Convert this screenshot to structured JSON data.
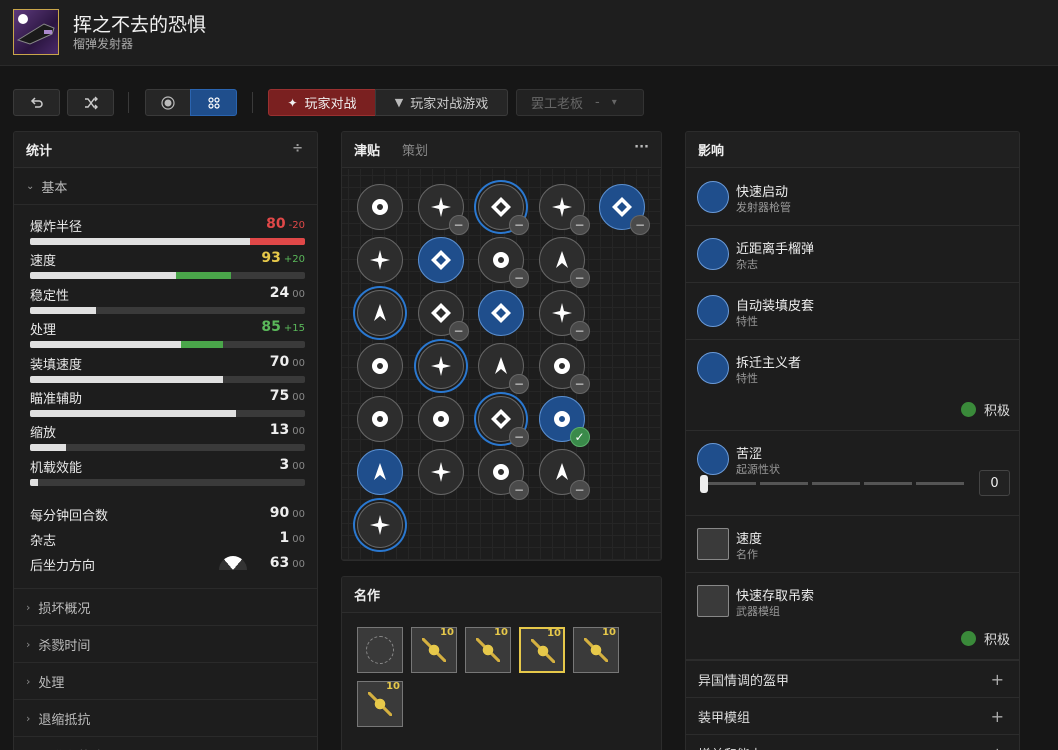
{
  "weapon": {
    "name": "挥之不去的恐惧",
    "type": "榴弹发射器",
    "accent": "#c9a64a"
  },
  "toolbar": {
    "undo_icon": "undo-icon",
    "shuffle_icon": "shuffle-icon",
    "view_toggle": [
      "radio-dot-icon",
      "grid-icon"
    ],
    "modes": [
      {
        "label": "玩家对战",
        "icon": "crucible-icon",
        "active": true
      },
      {
        "label": "玩家对战游戏",
        "icon": "vanguard-icon",
        "active": false
      }
    ],
    "loadout_select": {
      "value": "罢工老板",
      "dash": "-",
      "arrow": "▾"
    }
  },
  "stats": {
    "title": "统计",
    "section": "基本",
    "bars": [
      {
        "name": "爆炸半径",
        "value": "80",
        "delta": "-20",
        "value_color": "#e04848",
        "delta_color": "#e04848",
        "fill": 0.8,
        "change": -0.2,
        "change_color": "#e04848"
      },
      {
        "name": "速度",
        "value": "93",
        "delta": "+20",
        "value_color": "#e6c84a",
        "delta_color": "#5ab85a",
        "fill": 0.73,
        "change": 0.2,
        "change_color": "#4aa64a"
      },
      {
        "name": "稳定性",
        "value": "24",
        "delta": "00",
        "value_color": "#eeeeee",
        "delta_color": "#888888",
        "fill": 0.24,
        "change": 0,
        "change_color": ""
      },
      {
        "name": "处理",
        "value": "85",
        "delta": "+15",
        "value_color": "#5ab85a",
        "delta_color": "#5ab85a",
        "fill": 0.7,
        "change": 0.15,
        "change_color": "#4aa64a"
      },
      {
        "name": "装填速度",
        "value": "70",
        "delta": "00",
        "value_color": "#eeeeee",
        "delta_color": "#888888",
        "fill": 0.7,
        "change": 0,
        "change_color": ""
      },
      {
        "name": "瞄准辅助",
        "value": "75",
        "delta": "00",
        "value_color": "#eeeeee",
        "delta_color": "#888888",
        "fill": 0.75,
        "change": 0,
        "change_color": ""
      },
      {
        "name": "缩放",
        "value": "13",
        "delta": "00",
        "value_color": "#eeeeee",
        "delta_color": "#888888",
        "fill": 0.13,
        "change": 0,
        "change_color": ""
      },
      {
        "name": "机载效能",
        "value": "3",
        "delta": "00",
        "value_color": "#eeeeee",
        "delta_color": "#888888",
        "fill": 0.03,
        "change": 0,
        "change_color": ""
      }
    ],
    "plain": [
      {
        "name": "每分钟回合数",
        "value": "90",
        "delta": "00"
      },
      {
        "name": "杂志",
        "value": "1",
        "delta": "00"
      },
      {
        "name": "后坐力方向",
        "value": "63",
        "delta": "00"
      }
    ],
    "collapsed": [
      "损坏概况",
      "杀戮时间",
      "处理",
      "退缩抵抗",
      "瞄准和装填"
    ]
  },
  "perks": {
    "tabs": [
      "津贴",
      "策划"
    ],
    "menu": "···",
    "columns": [
      [
        {
          "icon": "rapid-launch-icon"
        },
        {
          "icon": "target-icon"
        },
        {
          "icon": "flame-icon",
          "ring": true
        },
        {
          "icon": "leaf-icon"
        },
        {
          "icon": "burst-icon"
        },
        {
          "icon": "ice-icon",
          "sel": true
        },
        {
          "icon": "feather-icon",
          "ring": true
        }
      ],
      [
        {
          "icon": "claw-icon",
          "minus": true
        },
        {
          "icon": "crosshair-icon",
          "sel": true
        },
        {
          "icon": "star-icon",
          "minus": true
        },
        {
          "icon": "slash-icon",
          "ring": true
        },
        {
          "icon": "reticle-icon"
        },
        {
          "icon": "sphere-icon"
        }
      ],
      [
        {
          "icon": "compass-icon",
          "ring": true,
          "minus": true
        },
        {
          "icon": "diamond-icon",
          "minus": true
        },
        {
          "icon": "auto-loading-holster-icon",
          "sel": true
        },
        {
          "icon": "bolt-icon",
          "minus": true
        },
        {
          "icon": "cross-icon",
          "ring": true,
          "minus": true
        },
        {
          "icon": "cycle-icon",
          "minus": true
        }
      ],
      [
        {
          "icon": "dragon-icon",
          "minus": true
        },
        {
          "icon": "wheel-icon",
          "minus": true
        },
        {
          "icon": "gear-icon",
          "minus": true
        },
        {
          "icon": "blade-icon",
          "minus": true
        },
        {
          "icon": "demolitionist-icon",
          "sel": true,
          "check": true
        },
        {
          "icon": "spark-icon",
          "minus": true
        }
      ],
      [
        {
          "icon": "bitter-icon",
          "sel": true,
          "minus": true
        }
      ]
    ]
  },
  "masterwork": {
    "title": "名作",
    "items": [
      {
        "icon": "empty-ring-icon",
        "level": "",
        "sel": false
      },
      {
        "icon": "blast-radius-mw-icon",
        "level": "10",
        "sel": false
      },
      {
        "icon": "handling-mw-icon",
        "level": "10",
        "sel": false
      },
      {
        "icon": "velocity-mw-icon",
        "level": "10",
        "sel": true
      },
      {
        "icon": "stability-mw-icon",
        "level": "10",
        "sel": false
      },
      {
        "icon": "reload-mw-icon",
        "level": "10",
        "sel": false
      }
    ]
  },
  "effects": {
    "title": "影响",
    "items": [
      {
        "title": "快速启动",
        "sub": "发射器枪管",
        "icon": "rapid-launch-icon"
      },
      {
        "title": "近距离手榴弹",
        "sub": "杂志",
        "icon": "grenade-icon"
      },
      {
        "title": "自动装填皮套",
        "sub": "特性",
        "icon": "auto-loading-holster-icon"
      },
      {
        "title": "拆迁主义者",
        "sub": "特性",
        "icon": "demolitionist-icon",
        "active": "积极"
      },
      {
        "title": "苦涩",
        "sub": "起源性状",
        "icon": "bitter-icon",
        "slider_value": "0",
        "slider_level": 0
      },
      {
        "title": "速度",
        "sub": "名作",
        "icon": "velocity-mw-icon"
      },
      {
        "title": "快速存取吊索",
        "sub": "武器模组",
        "icon": "quick-access-sling-icon",
        "active": "积极"
      }
    ],
    "expanders": [
      "异国情调的盔甲",
      "装甲模组",
      "增益和能力"
    ],
    "expand_icon": "+"
  }
}
